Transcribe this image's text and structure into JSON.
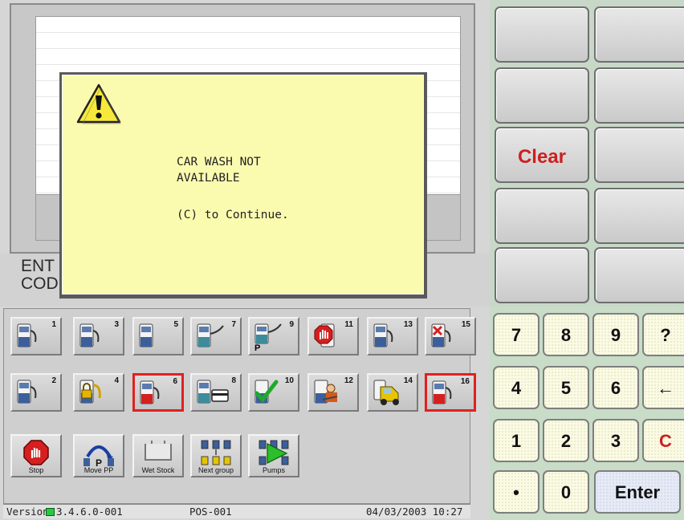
{
  "prompt": {
    "line1": "ENT",
    "line2": "COD"
  },
  "dialog": {
    "icon": "warning-icon",
    "message_line1": "CAR WASH NOT",
    "message_line2": "AVAILABLE",
    "instruction": "(C) to Continue."
  },
  "pumps": [
    {
      "number": "1",
      "state": "idle"
    },
    {
      "number": "2",
      "state": "idle"
    },
    {
      "number": "3",
      "state": "idle"
    },
    {
      "number": "4",
      "state": "locked"
    },
    {
      "number": "5",
      "state": "idle"
    },
    {
      "number": "6",
      "state": "active-red"
    },
    {
      "number": "7",
      "state": "nozzle-out"
    },
    {
      "number": "8",
      "state": "card"
    },
    {
      "number": "9",
      "state": "prepay",
      "badge": "P"
    },
    {
      "number": "10",
      "state": "completed"
    },
    {
      "number": "11",
      "state": "stopped"
    },
    {
      "number": "12",
      "state": "service"
    },
    {
      "number": "13",
      "state": "idle"
    },
    {
      "number": "14",
      "state": "forecourt-vehicle"
    },
    {
      "number": "15",
      "state": "error"
    },
    {
      "number": "16",
      "state": "active-red"
    }
  ],
  "functions": {
    "stop": "Stop",
    "move_pp": "Move PP",
    "move_pp_letter": "P",
    "wet_stock": "Wet Stock",
    "next_group": "Next group",
    "pumps": "Pumps"
  },
  "status": {
    "version_prefix": "Version ",
    "version_suffix": "3.4.6.0-001",
    "terminal": "POS-001",
    "datetime": "04/03/2003 10:27"
  },
  "function_keys": {
    "clear": "Clear"
  },
  "keypad": {
    "k7": "7",
    "k8": "8",
    "k9": "9",
    "kq": "?",
    "k4": "4",
    "k5": "5",
    "k6": "6",
    "kback": "←",
    "k1": "1",
    "k2": "2",
    "k3": "3",
    "kc": "C",
    "kdot": "•",
    "k0": "0",
    "enter": "Enter"
  },
  "colors": {
    "dialog_bg": "#fbfbb0",
    "accent_red": "#cc2020",
    "active_border": "#e02020"
  }
}
